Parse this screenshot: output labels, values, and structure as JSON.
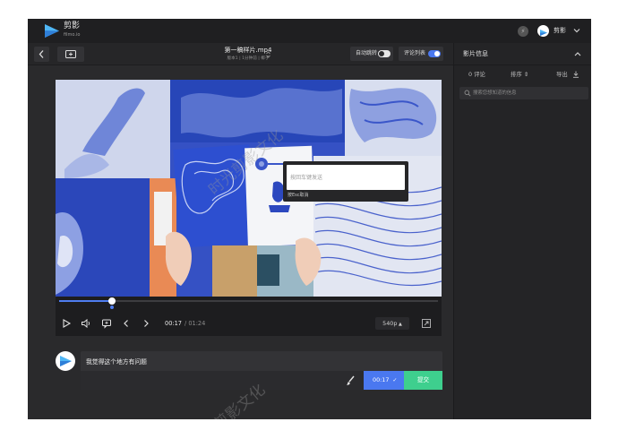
{
  "app": {
    "logo_name": "剪影",
    "logo_sub": "filmo.io",
    "user_name": "剪影",
    "brand_color": "#4a78f0",
    "submit_color": "#3ecf8e"
  },
  "toolbar": {
    "file_title": "第一稿样片.mp4",
    "file_meta": "版本1 | 1分钟前 | 椰子",
    "autoplay_label": "自动跳转",
    "autoplay_on": false,
    "comment_list_label": "评论列表",
    "comment_list_on": true
  },
  "side_panel": {
    "title": "影片信息",
    "tabs": [
      {
        "label": "0 评论"
      },
      {
        "label": "排序 ⇕"
      },
      {
        "label": "导出"
      }
    ],
    "search_placeholder": "搜索您想知道的信息"
  },
  "player": {
    "progress": 0.14,
    "markers": [
      0.14
    ],
    "current_time": "00:17",
    "total_time": "/ 01:24",
    "quality": "540p",
    "popup_placeholder": "按回车键发送",
    "popup_hint": "按Esc取消"
  },
  "composer": {
    "comment_text": "我觉得这个地方有问题",
    "timestamp": "00:17",
    "submit_label": "提交"
  },
  "watermark": {
    "text": "时光剪影文化"
  }
}
